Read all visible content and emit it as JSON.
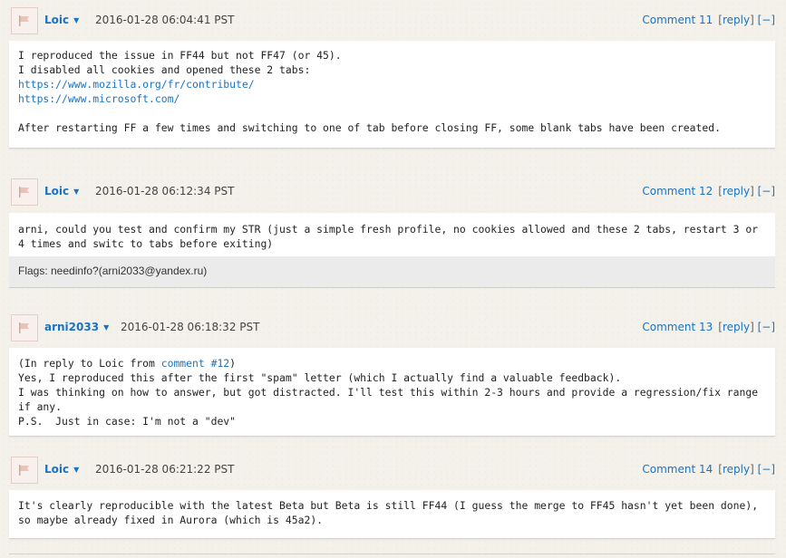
{
  "comments": [
    {
      "author": "Loic",
      "caret": "▼",
      "timestamp": "2016-01-28 06:04:41 PST",
      "number_label": "Comment 11",
      "reply_label": "reply",
      "collapse_label": "[−]",
      "lines": [
        "I reproduced the issue in FF44 but not FF47 (or 45).",
        "I disabled all cookies and opened these 2 tabs:"
      ],
      "links": [
        "https://www.mozilla.org/fr/contribute/",
        "https://www.microsoft.com/"
      ],
      "after_links": "After restarting FF a few times and switching to one of tab before closing FF, some blank tabs have been created."
    },
    {
      "author": "Loic",
      "caret": "▼",
      "timestamp": "2016-01-28 06:12:34 PST",
      "number_label": "Comment 12",
      "reply_label": "reply",
      "collapse_label": "[−]",
      "text": "arni, could you test and confirm my STR (just a simple fresh profile, no cookies allowed and these 2 tabs, restart 3 or 4 times and switc to tabs before exiting)",
      "flags": "Flags: needinfo?(arni2033@yandex.ru)"
    },
    {
      "author": "arni2033",
      "caret": "▼",
      "timestamp": "2016-01-28 06:18:32 PST",
      "number_label": "Comment 13",
      "reply_label": "reply",
      "collapse_label": "[−]",
      "reply_prefix": "(In reply to Loic from ",
      "reply_link": "comment #12",
      "reply_suffix": ")",
      "text": "Yes, I reproduced this after the first \"spam\" letter (which I actually find a valuable feedback).\nI was thinking on how to answer, but got distracted. I'll test this within 2-3 hours and provide a regression/fix range if any.\nP.S.  Just in case: I'm not a \"dev\""
    },
    {
      "author": "Loic",
      "caret": "▼",
      "timestamp": "2016-01-28 06:21:22 PST",
      "number_label": "Comment 14",
      "reply_label": "reply",
      "collapse_label": "[−]",
      "text": "It's clearly reproducible with the latest Beta but Beta is still FF44 (I guess the merge to FF45 hasn't yet been done), so maybe already fixed in Aurora (which is 45a2)."
    }
  ],
  "icons": {
    "avatar": "flag-icon"
  },
  "colors": {
    "link": "#1a73c2",
    "background": "#f3f1ea",
    "flags_bg": "#ebebeb"
  }
}
